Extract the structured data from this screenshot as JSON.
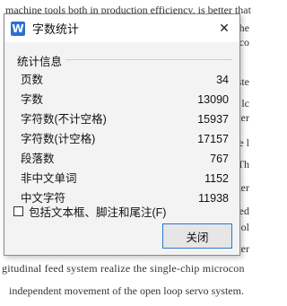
{
  "document": {
    "top_line": "machine tools both in production efficiency, is better that",
    "right_fragments": [
      "lathe",
      "roco",
      "ste",
      "lc",
      "ater",
      "e l",
      "Th",
      "ter",
      "ed",
      "ol",
      "lter"
    ],
    "bottom_line_1": "gitudinal feed system realize the single-chip microcon",
    "bottom_line_2": "independent movement of the open loop servo system."
  },
  "dialog": {
    "icon_glyph": "W",
    "title": "字数统计",
    "close_glyph": "✕",
    "group_title": "统计信息",
    "stats": [
      {
        "label": "页数",
        "value": "34"
      },
      {
        "label": "字数",
        "value": "13090"
      },
      {
        "label": "字符数(不计空格)",
        "value": "15937"
      },
      {
        "label": "字符数(计空格)",
        "value": "17157"
      },
      {
        "label": "段落数",
        "value": "767"
      },
      {
        "label": "非中文单词",
        "value": "1152"
      },
      {
        "label": "中文字符",
        "value": "11938"
      }
    ],
    "checkbox_label": "包括文本框、脚注和尾注(F)",
    "checkbox_checked": false,
    "close_button_label": "关闭"
  }
}
